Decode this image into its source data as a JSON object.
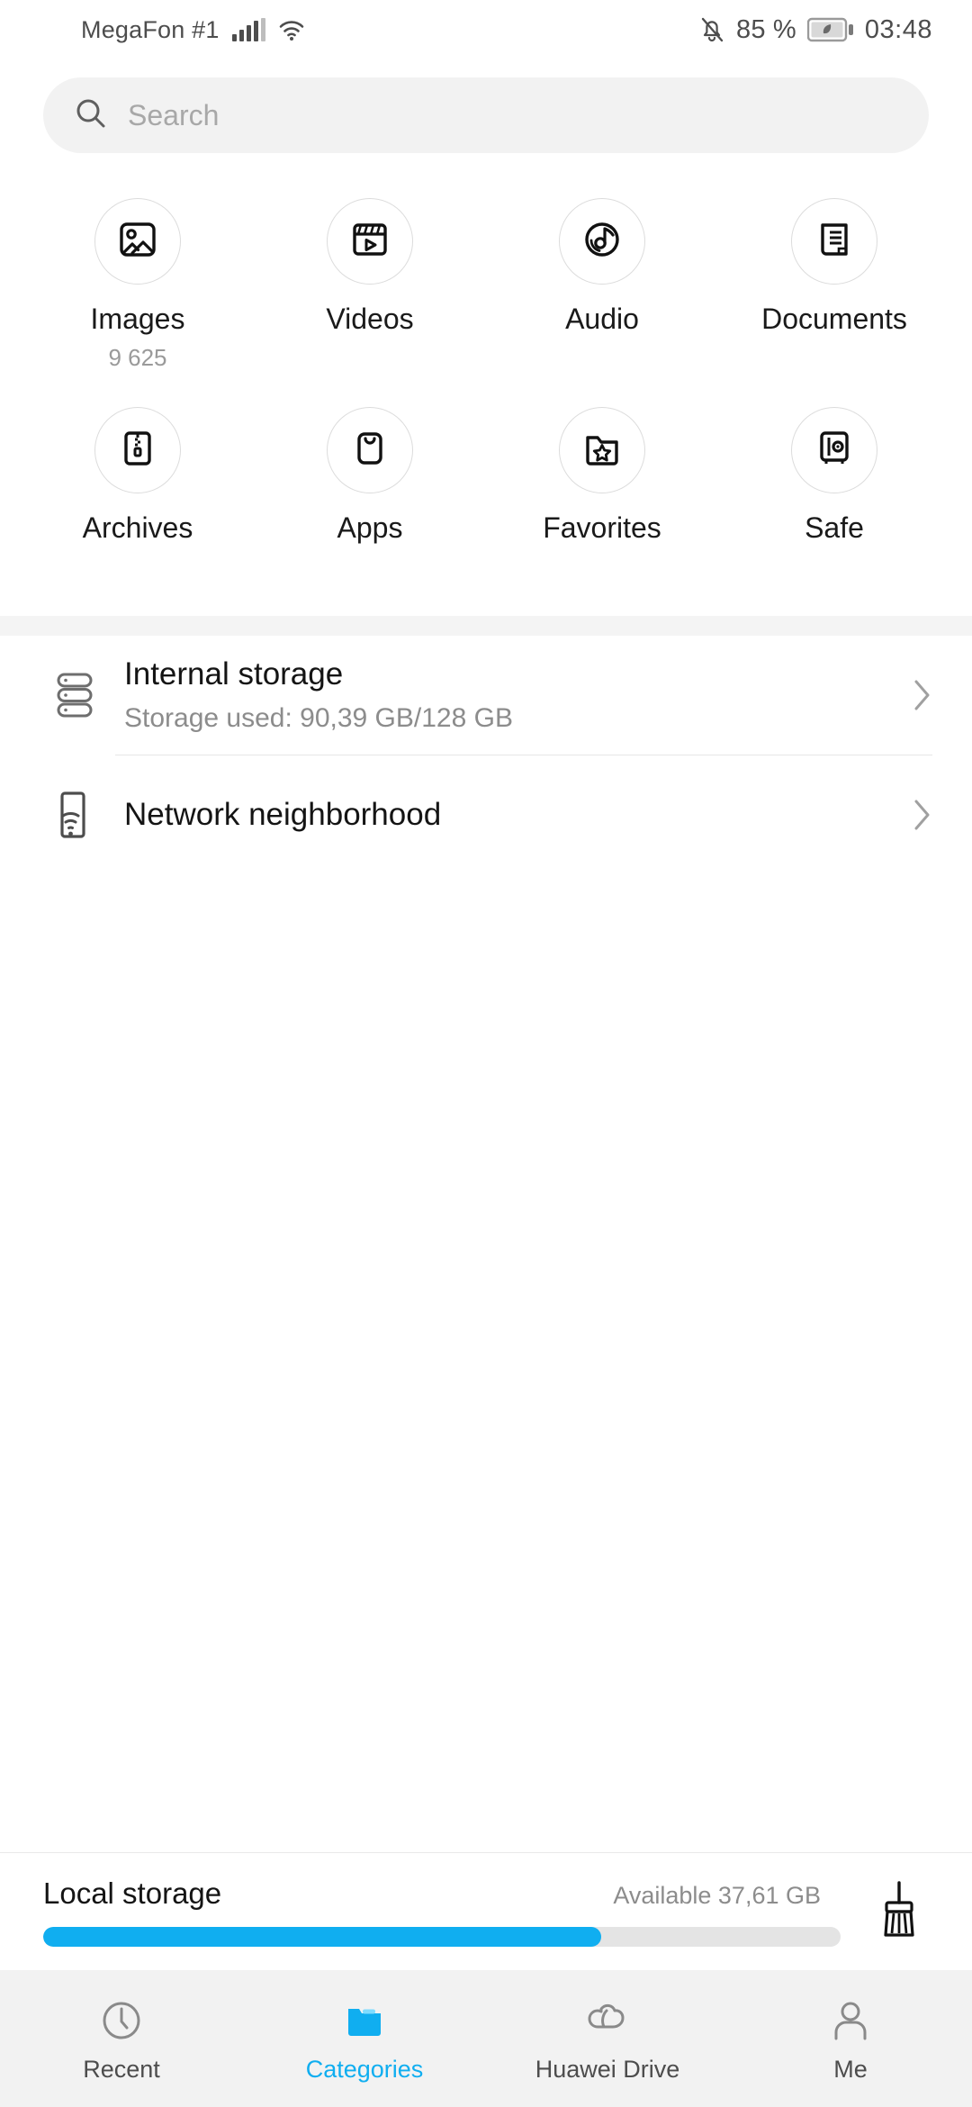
{
  "colors": {
    "accent": "#10AEF0",
    "text_primary": "#141414",
    "text_secondary": "#8c8c8c",
    "nav_bg": "#f2f2f2",
    "track": "#e4e4e4"
  },
  "status_bar": {
    "carrier": "MegaFon #1",
    "signal_icon": "signal-bars-icon",
    "wifi_icon": "wifi-icon",
    "mute_icon": "bell-muted-icon",
    "battery_percent": "85 %",
    "battery_icon": "battery-powersave-leaf-icon",
    "time": "03:48"
  },
  "search": {
    "icon": "search-icon",
    "placeholder": "Search",
    "value": ""
  },
  "categories": {
    "rows": [
      [
        {
          "label": "Images",
          "count": "9 625",
          "icon": "images-icon"
        },
        {
          "label": "Videos",
          "count": "",
          "icon": "videos-icon"
        },
        {
          "label": "Audio",
          "count": "",
          "icon": "audio-icon"
        },
        {
          "label": "Documents",
          "count": "",
          "icon": "documents-icon"
        }
      ],
      [
        {
          "label": "Archives",
          "count": "",
          "icon": "archives-icon"
        },
        {
          "label": "Apps",
          "count": "",
          "icon": "apps-icon"
        },
        {
          "label": "Favorites",
          "count": "",
          "icon": "favorites-icon"
        },
        {
          "label": "Safe",
          "count": "",
          "icon": "safe-icon"
        }
      ]
    ]
  },
  "storage_list": [
    {
      "title": "Internal storage",
      "subtitle": "Storage used: 90,39 GB/128 GB",
      "icon": "internal-storage-icon",
      "chevron": "chevron-right-icon"
    },
    {
      "title": "Network neighborhood",
      "subtitle": "",
      "icon": "network-neighborhood-icon",
      "chevron": "chevron-right-icon"
    }
  ],
  "local_storage": {
    "title": "Local storage",
    "available": "Available 37,61 GB",
    "used_percent": 70,
    "cleanup_icon": "broom-cleanup-icon"
  },
  "bottom_nav": {
    "items": [
      {
        "label": "Recent",
        "icon": "clock-icon",
        "active": false
      },
      {
        "label": "Categories",
        "icon": "folder-icon",
        "active": true
      },
      {
        "label": "Huawei Drive",
        "icon": "cloud-icon",
        "active": false
      },
      {
        "label": "Me",
        "icon": "person-icon",
        "active": false
      }
    ]
  }
}
